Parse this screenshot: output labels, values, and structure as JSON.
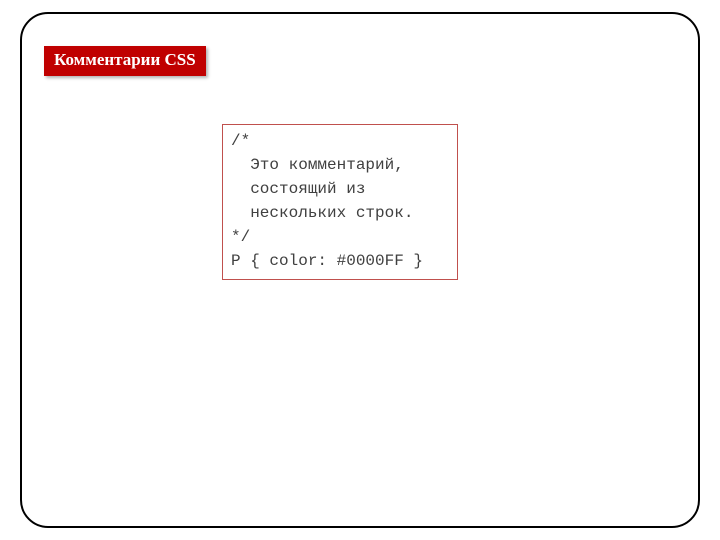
{
  "badge": {
    "label": "Комментарии CSS"
  },
  "code": {
    "lines": "/*\n  Это комментарий,\n  состоящий из\n  нескольких строк.\n*/\nP { color: #0000FF }"
  },
  "colors": {
    "badge_bg": "#c00000",
    "code_border": "#c0504d"
  }
}
